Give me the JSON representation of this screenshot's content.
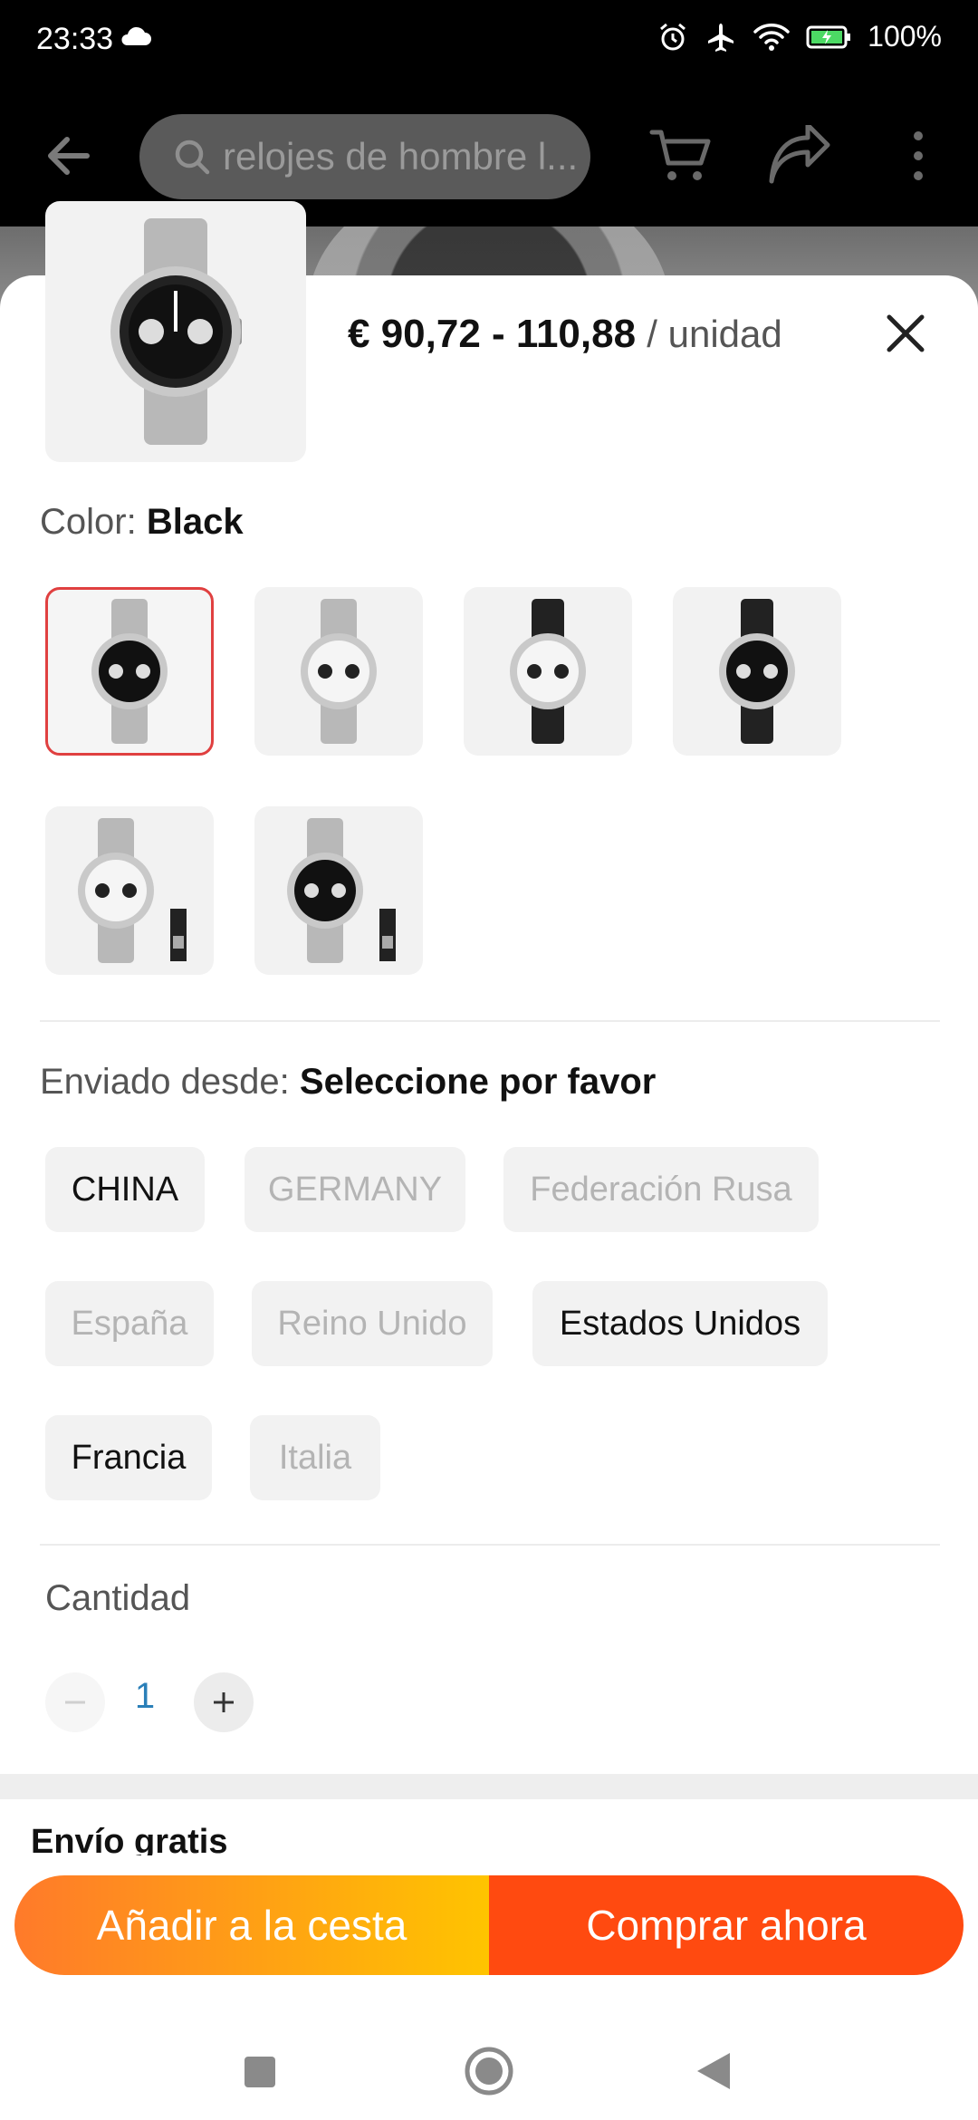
{
  "status_bar": {
    "time": "23:33",
    "battery": "100%"
  },
  "search": {
    "placeholder": "relojes de hombre l..."
  },
  "product": {
    "price": "€ 90,72 - 110,88",
    "unit": "/ unidad"
  },
  "color": {
    "label": "Color:",
    "selected": "Black",
    "swatches": [
      {
        "name": "black-dial-bracelet",
        "selected": true
      },
      {
        "name": "white-dial-bracelet",
        "selected": false
      },
      {
        "name": "white-dial-strap",
        "selected": false
      },
      {
        "name": "black-dial-strap",
        "selected": false
      },
      {
        "name": "white-dial-with-box",
        "selected": false
      },
      {
        "name": "black-dial-with-box",
        "selected": false
      }
    ]
  },
  "shipping": {
    "label": "Enviado desde:",
    "selected": "Seleccione por favor",
    "options": [
      {
        "label": "CHINA",
        "available": true
      },
      {
        "label": "GERMANY",
        "available": false
      },
      {
        "label": "Federación Rusa",
        "available": false
      },
      {
        "label": "España",
        "available": false
      },
      {
        "label": "Reino Unido",
        "available": false
      },
      {
        "label": "Estados Unidos",
        "available": true
      },
      {
        "label": "Francia",
        "available": true
      },
      {
        "label": "Italia",
        "available": false
      }
    ]
  },
  "quantity": {
    "label": "Cantidad",
    "value": "1"
  },
  "free_shipping": "Envío gratis",
  "cta": {
    "add_to_cart": "Añadir a la cesta",
    "buy_now": "Comprar ahora"
  },
  "colors": {
    "accent": "#ff4a10",
    "selected_border": "#e04040",
    "cart_gradient_start": "#ff7a2a",
    "cart_gradient_end": "#ffc400"
  }
}
